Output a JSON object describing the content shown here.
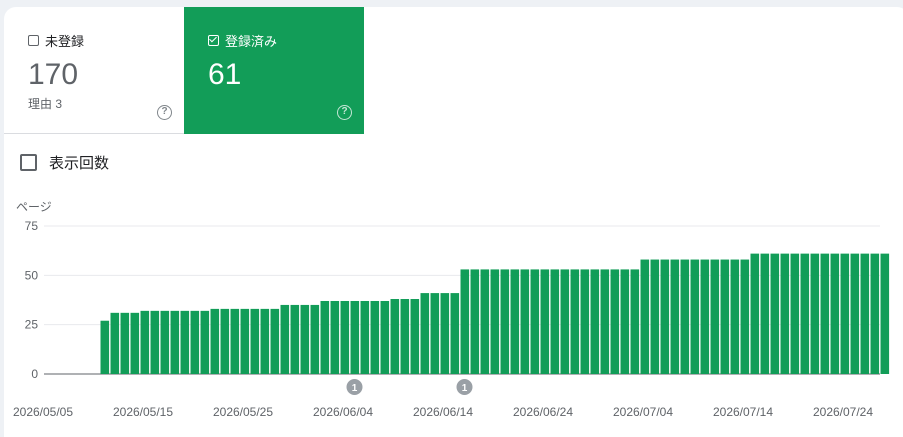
{
  "tiles": {
    "unregistered": {
      "label": "未登録",
      "value": "170",
      "sub": "理由 3",
      "help": "?"
    },
    "registered": {
      "label": "登録済み",
      "value": "61",
      "help": "?"
    }
  },
  "impressions": {
    "label": "表示回数",
    "checked": false
  },
  "colors": {
    "accent": "#129d58",
    "bar": "#129d58",
    "grid": "#e8eaed",
    "marker": "#9aa0a6"
  },
  "chart_data": {
    "type": "bar",
    "ylabel": "ページ",
    "ylim": [
      0,
      75
    ],
    "yticks": [
      0,
      25,
      50,
      75
    ],
    "x_start": "2026/05/05",
    "x_tick_labels": [
      "2026/05/05",
      "2026/05/15",
      "2026/05/25",
      "2026/06/04",
      "2026/06/14",
      "2026/06/24",
      "2026/07/04",
      "2026/07/14",
      "2026/07/24"
    ],
    "series": [
      {
        "start_date": "2026/05/11",
        "values": [
          27,
          31,
          31,
          31,
          32,
          32,
          32,
          32,
          32,
          32,
          32,
          33,
          33,
          33,
          33,
          33,
          33,
          33,
          35,
          35,
          35,
          35,
          37,
          37,
          37,
          37,
          37,
          37,
          37,
          38,
          38,
          38,
          41,
          41,
          41,
          41,
          53,
          53,
          53,
          53,
          53,
          53,
          53,
          53,
          53,
          53,
          53,
          53,
          53,
          53,
          53,
          53,
          53,
          53,
          58,
          58,
          58,
          58,
          58,
          58,
          58,
          58,
          58,
          58,
          58,
          61,
          61,
          61,
          61,
          61,
          61,
          61,
          61,
          61,
          61,
          61,
          61,
          61,
          61
        ]
      }
    ],
    "annotations": [
      {
        "date": "2026/06/05",
        "label": "1"
      },
      {
        "date": "2026/06/16",
        "label": "1"
      }
    ],
    "grid": true
  }
}
